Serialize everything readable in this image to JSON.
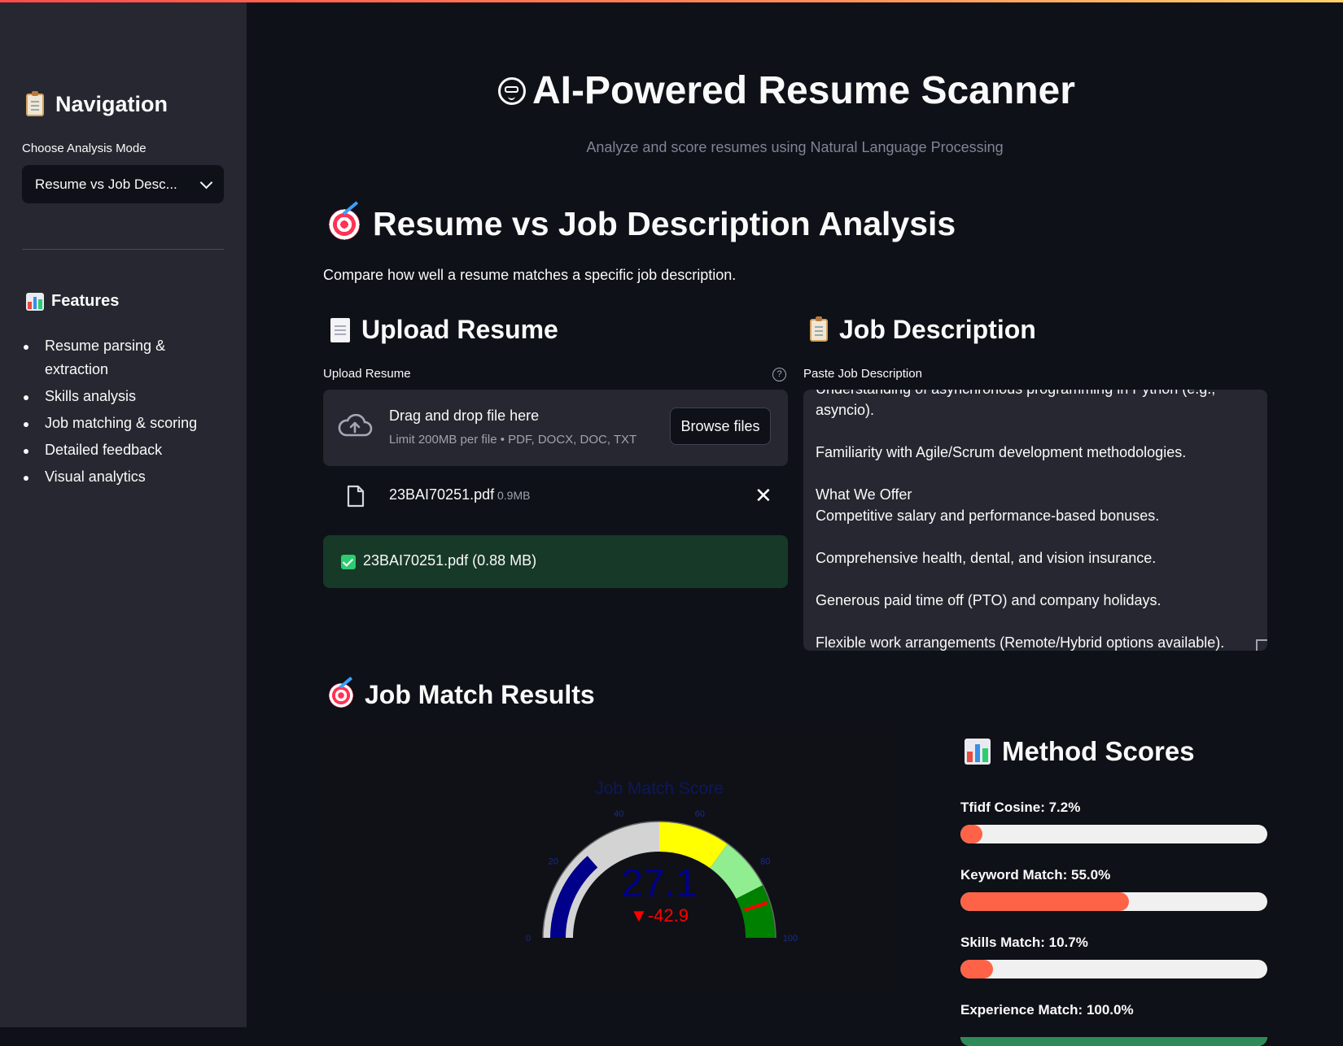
{
  "sidebar": {
    "nav_title": "Navigation",
    "mode_label": "Choose Analysis Mode",
    "mode_value": "Resume vs Job Desc...",
    "features_title": "Features",
    "features": [
      "Resume parsing & extraction",
      "Skills analysis",
      "Job matching & scoring",
      "Detailed feedback",
      "Visual analytics"
    ]
  },
  "header": {
    "title": "AI-Powered Resume Scanner",
    "subtitle": "Analyze and score resumes using Natural Language Processing"
  },
  "section": {
    "title": "Resume vs Job Description Analysis",
    "description": "Compare how well a resume matches a specific job description."
  },
  "upload": {
    "heading": "Upload Resume",
    "label": "Upload Resume",
    "drop_text": "Drag and drop file here",
    "limit_text": "Limit 200MB per file • PDF, DOCX, DOC, TXT",
    "browse_label": "Browse files",
    "file_name": "23BAI70251.pdf",
    "file_size": "0.9MB",
    "success_text": "23BAI70251.pdf (0.88 MB)"
  },
  "job": {
    "heading": "Job Description",
    "label": "Paste Job Description",
    "text": "Understanding of asynchronous programming in Python (e.g.,\nasyncio).\n\nFamiliarity with Agile/Scrum development methodologies.\n\nWhat We Offer\nCompetitive salary and performance-based bonuses.\n\nComprehensive health, dental, and vision insurance.\n\nGenerous paid time off (PTO) and company holidays.\n\nFlexible work arrangements (Remote/Hybrid options available)."
  },
  "results": {
    "title": "Job Match Results"
  },
  "chart_data": {
    "type": "gauge",
    "title": "Job Match Score",
    "value": 27.1,
    "delta": "▼-42.9",
    "range": [
      0,
      100
    ],
    "tick_labels": [
      "0",
      "20",
      "40",
      "60",
      "80",
      "100"
    ],
    "bar_color": "#00008b",
    "steps": [
      {
        "range": [
          0,
          50
        ],
        "color": "#d3d3d3"
      },
      {
        "range": [
          50,
          70
        ],
        "color": "#ffff00"
      },
      {
        "range": [
          70,
          85
        ],
        "color": "#90ee90"
      },
      {
        "range": [
          85,
          100
        ],
        "color": "#008000"
      }
    ],
    "threshold": {
      "value": 90,
      "color": "#ff0000"
    }
  },
  "method_scores": {
    "title": "Method Scores",
    "items": [
      {
        "label": "Tfidf Cosine: 7.2%",
        "value": 7.2,
        "color": "#ff6347"
      },
      {
        "label": "Keyword Match: 55.0%",
        "value": 55.0,
        "color": "#ff6347"
      },
      {
        "label": "Skills Match: 10.7%",
        "value": 10.7,
        "color": "#ff6347"
      },
      {
        "label": "Experience Match: 100.0%",
        "value": 100.0,
        "color": "#2e8b57"
      }
    ]
  }
}
